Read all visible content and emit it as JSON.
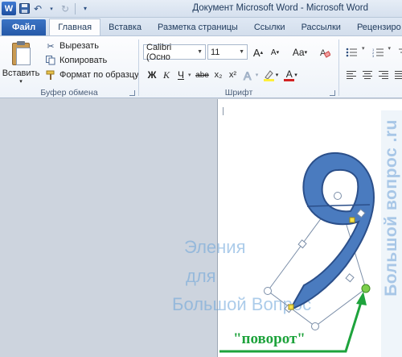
{
  "app": {
    "logo": "W",
    "title": "Документ Microsoft Word  -  Microsoft Word"
  },
  "tabs": [
    "Файл",
    "Главная",
    "Вставка",
    "Разметка страницы",
    "Ссылки",
    "Рассылки",
    "Рецензиро"
  ],
  "clipboard": {
    "paste_label": "Вставить",
    "cut_label": "Вырезать",
    "copy_label": "Копировать",
    "format_painter_label": "Формат по образцу",
    "group_label": "Буфер обмена"
  },
  "font": {
    "font_name": "Calibri (Осно",
    "font_size": "11",
    "group_label": "Шрифт",
    "bold": "Ж",
    "italic": "К",
    "underline": "Ч",
    "strike": "abe",
    "subscript": "x₂",
    "superscript": "x²",
    "grow": "A",
    "shrink": "A",
    "case": "Aa",
    "font_color": "A"
  },
  "document": {
    "digit": "9",
    "watermark_lines": [
      "Эления",
      "для",
      "Большой Вопрос"
    ],
    "vertical_watermark": "Большой вопрос .ru",
    "annotation": "\"поворот\""
  },
  "colors": {
    "digit_fill": "#4a7bbf",
    "digit_stroke": "#2b4f8a",
    "handle_green": "#7ccf4c",
    "handle_yellow": "#f4e04a",
    "arrow_green": "#1ea33c",
    "file_tab": "#2f67b7"
  }
}
